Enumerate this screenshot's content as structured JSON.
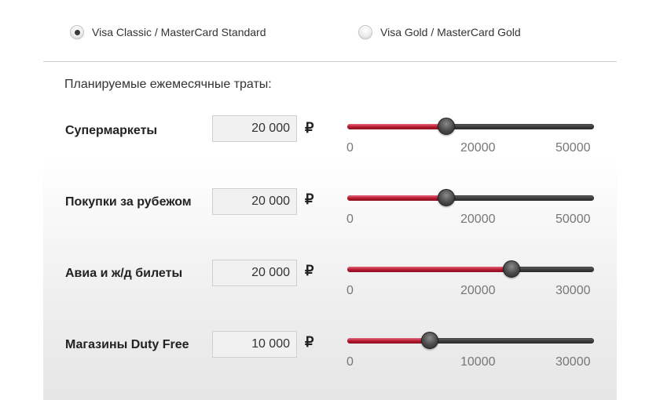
{
  "card_options": [
    {
      "label": "Visa Classic / MasterCard Standard",
      "selected": true
    },
    {
      "label": "Visa Gold / MasterCard Gold",
      "selected": false
    }
  ],
  "section_title": "Планируемые ежемесячные траты:",
  "currency_symbol": "₽",
  "rows": [
    {
      "label": "Супермаркеты",
      "amount": "20 000",
      "slider": {
        "min": 0,
        "max": 50000,
        "value": 20000,
        "ticks": [
          "0",
          "20000",
          "50000"
        ]
      }
    },
    {
      "label": "Покупки за рубежом",
      "amount": "20 000",
      "slider": {
        "min": 0,
        "max": 50000,
        "value": 20000,
        "ticks": [
          "0",
          "20000",
          "50000"
        ]
      }
    },
    {
      "label": "Авиа и ж/д билеты",
      "amount": "20 000",
      "slider": {
        "min": 0,
        "max": 30000,
        "value": 20000,
        "ticks": [
          "0",
          "20000",
          "30000"
        ]
      }
    },
    {
      "label": "Магазины Duty Free",
      "amount": "10 000",
      "slider": {
        "min": 0,
        "max": 30000,
        "value": 10000,
        "ticks": [
          "0",
          "10000",
          "30000"
        ]
      }
    }
  ],
  "colors": {
    "slider_fill": "#b3182e",
    "slider_track": "#3d3d3d"
  }
}
